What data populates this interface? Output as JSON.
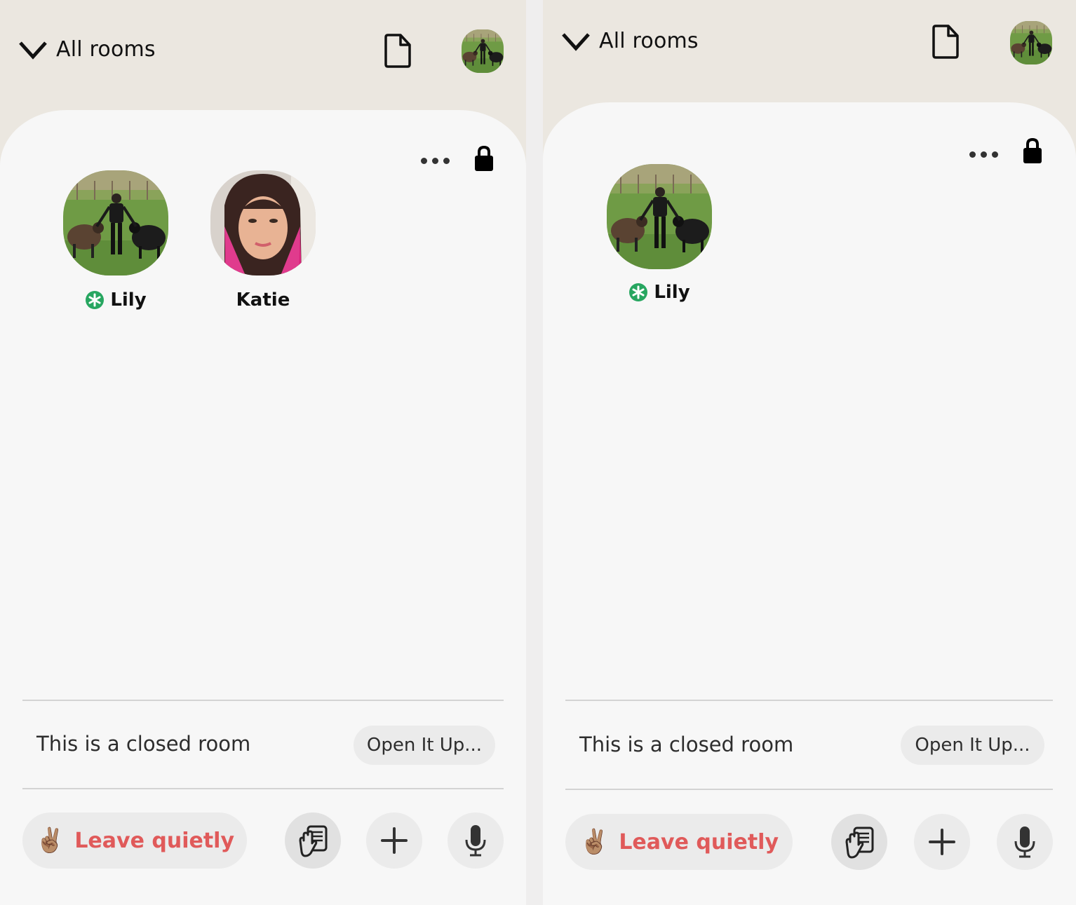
{
  "colors": {
    "header_bg": "#ebe7e0",
    "card_bg": "#f7f7f7",
    "leave_text": "#e05a5a",
    "moderator_badge": "#27a660",
    "button_bg": "#ebebeb"
  },
  "panels": [
    {
      "header": {
        "rooms_label": "All rooms",
        "chevron_icon": "chevron-down-icon",
        "doc_icon": "document-icon",
        "profile_avatar": "avatar-photo-sheep"
      },
      "room": {
        "more_icon": "more-horizontal-icon",
        "lock_icon": "lock-icon",
        "speakers": [
          {
            "name": "Lily",
            "moderator": true,
            "avatar": "avatar-photo-sheep"
          },
          {
            "name": "Katie",
            "moderator": false,
            "avatar": "avatar-photo-pink-hair"
          }
        ],
        "closed_text": "This is a closed room",
        "open_button": "Open It Up...",
        "leave_emoji": "✌🏽",
        "leave_label": "Leave quietly",
        "raise_hand_icon": "raise-hand-icon",
        "add_icon": "plus-icon",
        "mic_icon": "microphone-icon"
      }
    },
    {
      "header": {
        "rooms_label": "All rooms",
        "chevron_icon": "chevron-down-icon",
        "doc_icon": "document-icon",
        "profile_avatar": "avatar-photo-sheep"
      },
      "room": {
        "more_icon": "more-horizontal-icon",
        "lock_icon": "lock-icon",
        "speakers": [
          {
            "name": "Lily",
            "moderator": true,
            "avatar": "avatar-photo-sheep"
          }
        ],
        "closed_text": "This is a closed room",
        "open_button": "Open It Up...",
        "leave_emoji": "✌🏽",
        "leave_label": "Leave quietly",
        "raise_hand_icon": "raise-hand-icon",
        "add_icon": "plus-icon",
        "mic_icon": "microphone-icon"
      }
    }
  ]
}
